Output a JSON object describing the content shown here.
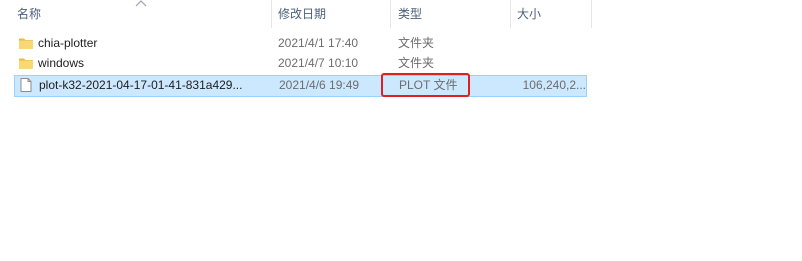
{
  "columns": {
    "name": "名称",
    "date": "修改日期",
    "type": "类型",
    "size": "大小"
  },
  "files": [
    {
      "name": "chia-plotter",
      "date": "2021/4/1 17:40",
      "type": "文件夹",
      "size": "",
      "icon": "folder-icon"
    },
    {
      "name": "windows",
      "date": "2021/4/7 10:10",
      "type": "文件夹",
      "size": "",
      "icon": "folder-icon"
    },
    {
      "name": "plot-k32-2021-04-17-01-41-831a429...",
      "date": "2021/4/6 19:49",
      "type": "PLOT 文件",
      "size": "106,240,2...",
      "icon": "file-icon"
    }
  ],
  "colors": {
    "selected_bg": "#cce8ff",
    "selected_border": "#99d1ff",
    "highlight": "#e02020",
    "folder": "#f8d775"
  }
}
